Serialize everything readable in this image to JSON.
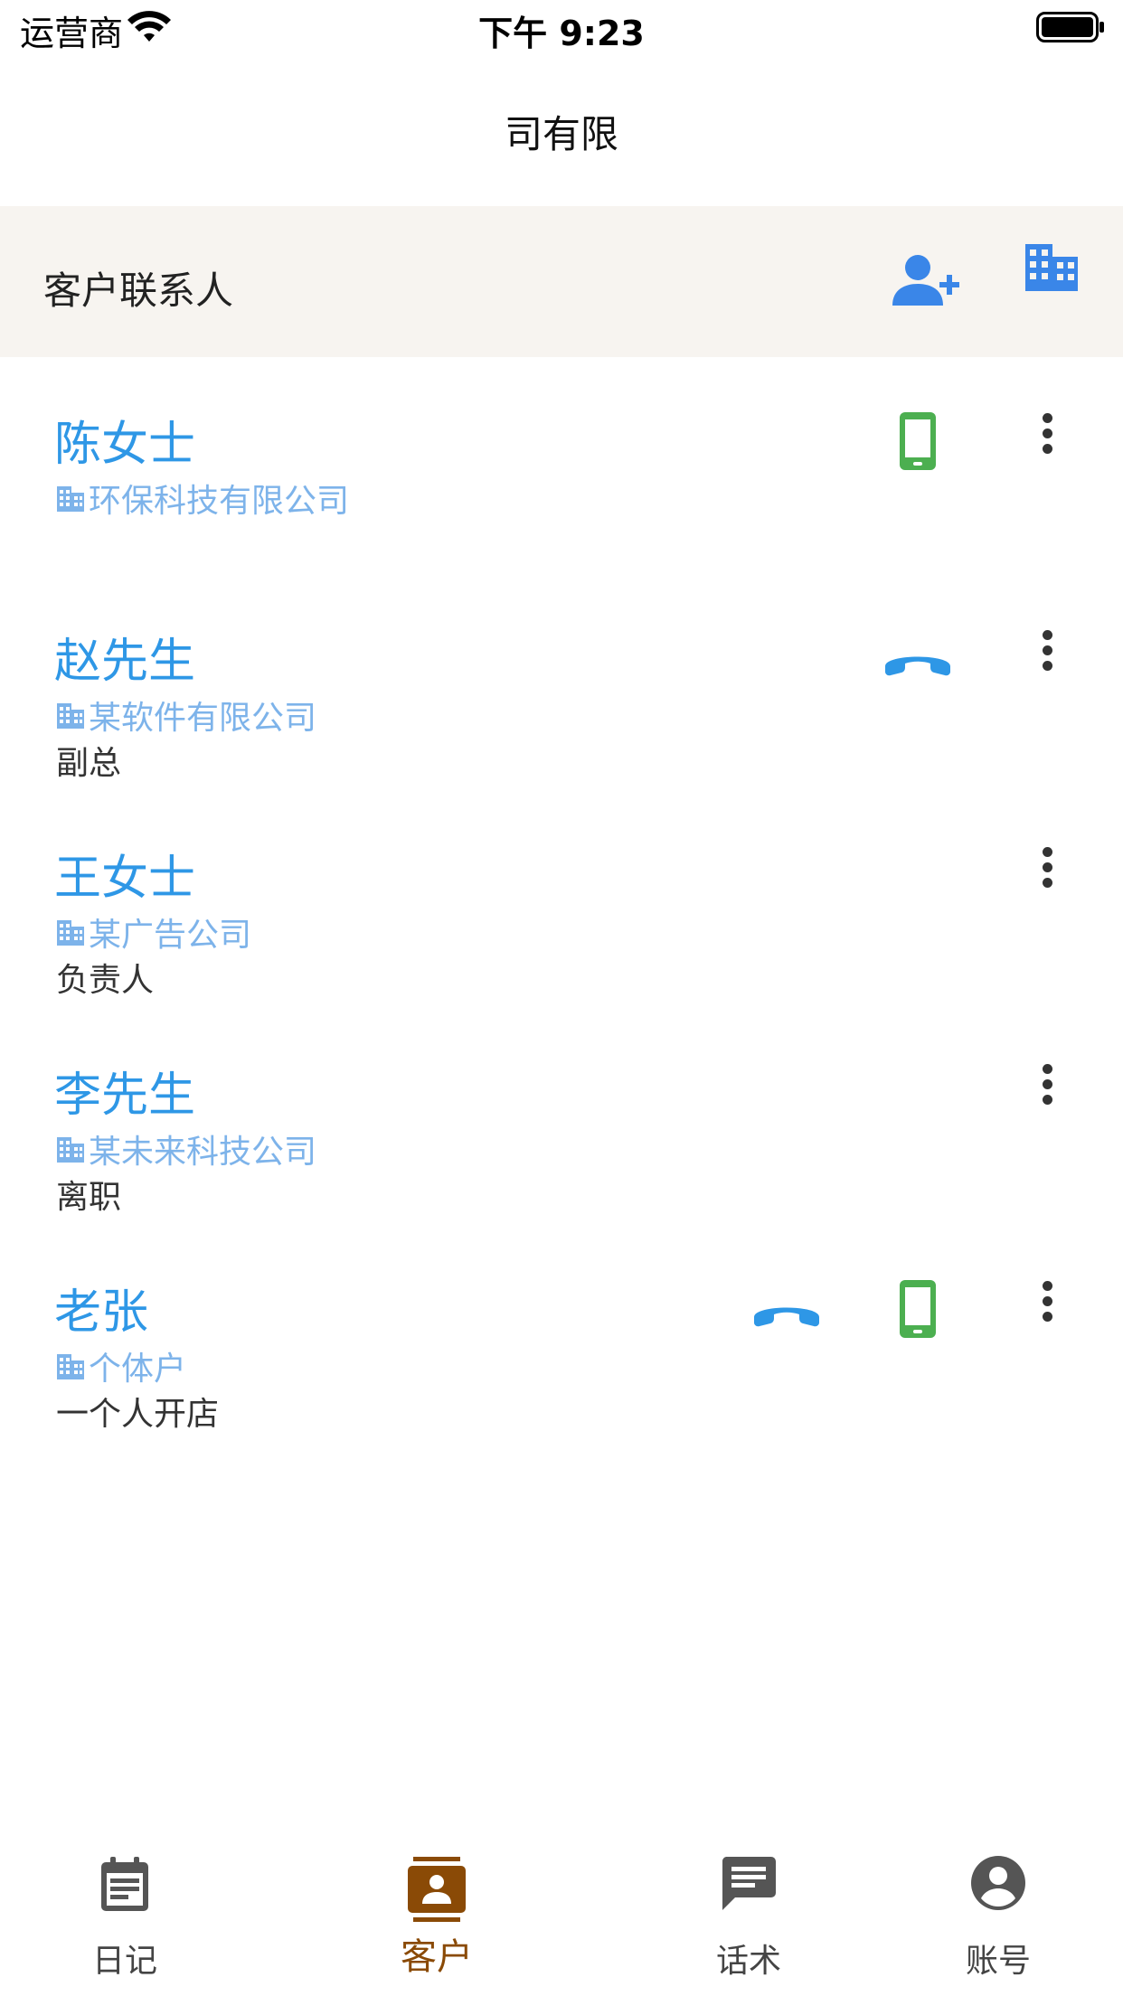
{
  "status_bar": {
    "carrier": "运营商",
    "time": "下午 9:23"
  },
  "nav": {
    "title": "司有限"
  },
  "section": {
    "title": "客户联系人"
  },
  "contacts": [
    {
      "name": "陈女士",
      "company": "环保科技有限公司",
      "note": "",
      "has_phone": false,
      "has_mobile": true
    },
    {
      "name": "赵先生",
      "company": "某软件有限公司",
      "note": "副总",
      "has_phone": true,
      "has_mobile": false
    },
    {
      "name": "王女士",
      "company": "某广告公司",
      "note": "负责人",
      "has_phone": false,
      "has_mobile": false
    },
    {
      "name": "李先生",
      "company": "某未来科技公司",
      "note": "离职",
      "has_phone": false,
      "has_mobile": false
    },
    {
      "name": "老张",
      "company": "个体户",
      "note": "一个人开店",
      "has_phone": true,
      "has_mobile": true
    }
  ],
  "tabs": [
    {
      "label": "日记",
      "icon": "diary-icon",
      "active": false
    },
    {
      "label": "客户",
      "icon": "contacts-icon",
      "active": true
    },
    {
      "label": "话术",
      "icon": "chat-icon",
      "active": false
    },
    {
      "label": "账号",
      "icon": "account-icon",
      "active": false
    }
  ],
  "colors": {
    "accent_blue": "#2e97e6",
    "company_blue": "#7db3ea",
    "mobile_green": "#4caf50",
    "active_tab": "#8a4a06",
    "header_bg": "#f7f4f0"
  }
}
